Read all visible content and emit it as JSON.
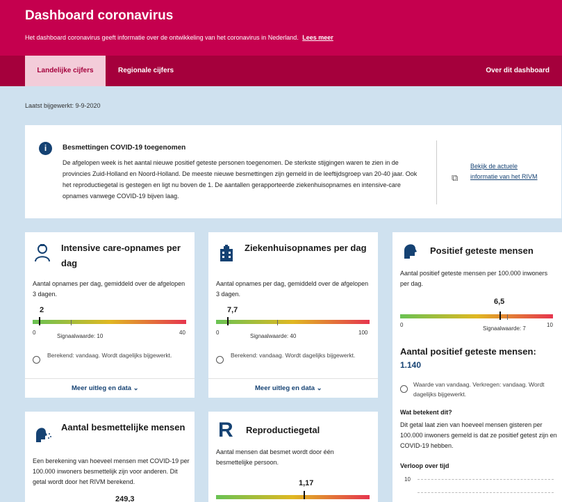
{
  "header": {
    "title": "Dashboard coronavirus",
    "subtitle": "Het dashboard coronavirus geeft informatie over de ontwikkeling van het coronavirus in Nederland.",
    "link": "Lees meer",
    "color": "#c5004e"
  },
  "nav": {
    "tabs": [
      "Landelijke cijfers",
      "Regionale cijfers"
    ],
    "right": "Over dit dashboard"
  },
  "updated": "Laatst bijgewerkt: 9-9-2020",
  "alert": {
    "title": "Besmettingen COVID-19 toegenomen",
    "body": "De afgelopen week is het aantal nieuwe positief geteste personen toegenomen. De sterkste stijgingen waren te zien in de provincies Zuid-Holland en Noord-Holland. De meeste nieuwe besmettingen zijn gemeld in de leeftijdsgroep van 20-40 jaar. Ook het reproductiegetal is gestegen en ligt nu boven de 1. De aantallen gerapporteerde ziekenhuisopnames en intensive-care opnames vanwege COVID-19 bijven laag.",
    "link": "Bekijk de actuele informatie van het RIVM",
    "icon": "info-icon"
  },
  "ic": {
    "title": "Intensive care-opnames per dag",
    "desc": "Aantal opnames per dag, gemiddeld over de afgelopen 3 dagen.",
    "value": "2",
    "value_num": 2,
    "scale_min": "0",
    "scale_max": "40",
    "max_num": 40,
    "signal": "Signaalwaarde: 10",
    "signal_num": 10,
    "meta": "Berekend: vandaag. Wordt dagelijks bijgewerkt.",
    "more": "Meer uitleg en data ⌄",
    "icon": "nurse-icon"
  },
  "hosp": {
    "title": "Ziekenhuisopnames per dag",
    "desc": "Aantal opnames per dag, gemiddeld over de afgelopen 3 dagen.",
    "value": "7,7",
    "value_num": 7.7,
    "scale_min": "0",
    "scale_max": "100",
    "max_num": 100,
    "signal": "Signaalwaarde: 40",
    "signal_num": 40,
    "meta": "Berekend: vandaag. Wordt dagelijks bijgewerkt.",
    "more": "Meer uitleg en data ⌄",
    "icon": "hospital-icon"
  },
  "pos": {
    "title": "Positief geteste mensen",
    "desc": "Aantal positief geteste mensen per 100.000 inwoners per dag.",
    "value": "6,5",
    "value_num": 6.5,
    "scale_min": "0",
    "scale_max": "10",
    "max_num": 10,
    "signal": "Signaalwaarde: 7",
    "signal_num": 7,
    "count_title": "Aantal positief geteste mensen:",
    "count": "1.140",
    "meta": "Waarde van vandaag. Verkregen: vandaag. Wordt dagelijks bijgewerkt.",
    "what_title": "Wat betekent dit?",
    "what_body": "Dit getal laat zien van hoeveel mensen gisteren per 100.000 inwoners gemeld is dat ze positief getest zijn en COVID-19 hebben.",
    "trend_title": "Verloop over tijd",
    "trend_tick": "10",
    "icon": "head-icon"
  },
  "inf": {
    "title": "Aantal besmettelijke mensen",
    "desc": "Een berekening van hoeveel mensen met COVID-19 per 100.000 inwoners besmettelijk zijn voor anderen. Dit getal wordt door het RIVM berekend.",
    "value": "249,3",
    "icon": "sneeze-icon"
  },
  "rep": {
    "title": "Reproductiegetal",
    "desc": "Aantal mensen dat besmet wordt door één besmettelijke persoon.",
    "value": "1,17",
    "letter": "R"
  }
}
